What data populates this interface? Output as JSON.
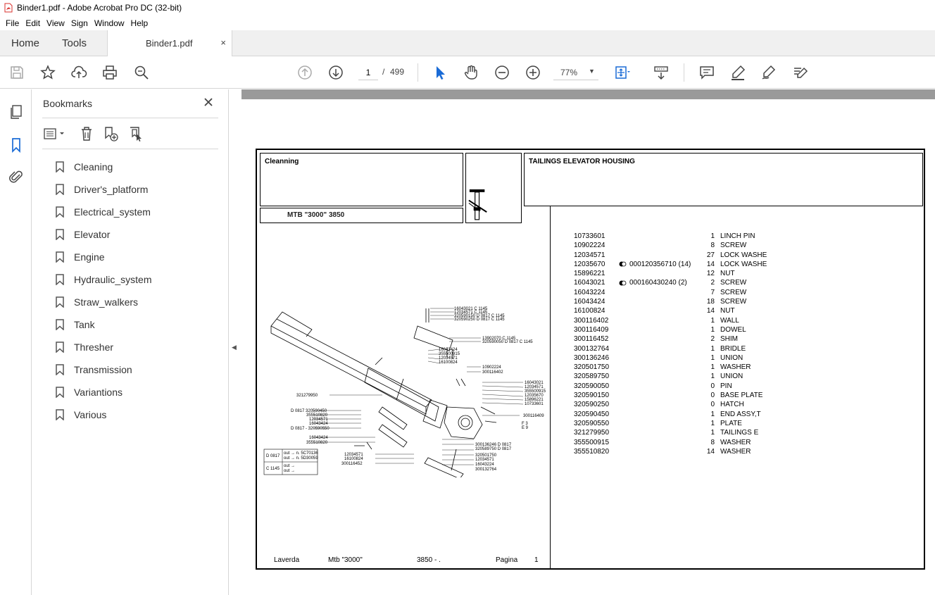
{
  "window": {
    "title": "Binder1.pdf - Adobe Acrobat Pro DC (32-bit)"
  },
  "menu": [
    "File",
    "Edit",
    "View",
    "Sign",
    "Window",
    "Help"
  ],
  "tabs": {
    "home": "Home",
    "tools": "Tools",
    "document": "Binder1.pdf",
    "close": "×"
  },
  "toolbar": {
    "page_current": "1",
    "page_separator": "/",
    "page_total": "499",
    "zoom": "77%"
  },
  "bookmarks": {
    "title": "Bookmarks",
    "close": "✕",
    "items": [
      "Cleaning",
      "Driver's_platform",
      "Electrical_system",
      "Elevator",
      "Engine",
      "Hydraulic_system",
      "Straw_walkers",
      "Tank",
      "Thresher",
      "Transmission",
      "Variantions",
      "Various"
    ]
  },
  "document": {
    "section": "Cleanning",
    "model_box": "MTB \"3000\" 3850",
    "heading": "TAILINGS ELEVATOR HOUSING",
    "parts": [
      {
        "num": "10733601",
        "ref": "",
        "qty": "1",
        "desc": "LINCH PIN"
      },
      {
        "num": "10902224",
        "ref": "",
        "qty": "8",
        "desc": "SCREW"
      },
      {
        "num": "12034571",
        "ref": "",
        "qty": "27",
        "desc": "LOCK WASHE"
      },
      {
        "num": "12035670",
        "ref": "000120356710  (14)",
        "qty": "14",
        "desc": "LOCK WASHE"
      },
      {
        "num": "15896221",
        "ref": "",
        "qty": "12",
        "desc": "NUT"
      },
      {
        "num": "16043021",
        "ref": "000160430240  (2)",
        "qty": "2",
        "desc": "SCREW"
      },
      {
        "num": "16043224",
        "ref": "",
        "qty": "7",
        "desc": "SCREW"
      },
      {
        "num": "16043424",
        "ref": "",
        "qty": "18",
        "desc": "SCREW"
      },
      {
        "num": "16100824",
        "ref": "",
        "qty": "14",
        "desc": "NUT"
      },
      {
        "num": "300116402",
        "ref": "",
        "qty": "1",
        "desc": "WALL"
      },
      {
        "num": "300116409",
        "ref": "",
        "qty": "1",
        "desc": "DOWEL"
      },
      {
        "num": "300116452",
        "ref": "",
        "qty": "2",
        "desc": "SHIM"
      },
      {
        "num": "300132764",
        "ref": "",
        "qty": "1",
        "desc": "BRIDLE"
      },
      {
        "num": "300136246",
        "ref": "",
        "qty": "1",
        "desc": "UNION"
      },
      {
        "num": "320501750",
        "ref": "",
        "qty": "1",
        "desc": "WASHER"
      },
      {
        "num": "320589750",
        "ref": "",
        "qty": "1",
        "desc": "UNION"
      },
      {
        "num": "320590050",
        "ref": "",
        "qty": "0",
        "desc": "PIN"
      },
      {
        "num": "320590150",
        "ref": "",
        "qty": "0",
        "desc": "BASE PLATE"
      },
      {
        "num": "320590250",
        "ref": "",
        "qty": "0",
        "desc": "HATCH"
      },
      {
        "num": "320590450",
        "ref": "",
        "qty": "1",
        "desc": "END ASSY,T"
      },
      {
        "num": "320590550",
        "ref": "",
        "qty": "1",
        "desc": "PLATE"
      },
      {
        "num": "321279950",
        "ref": "",
        "qty": "1",
        "desc": "TAILINGS E"
      },
      {
        "num": "355500915",
        "ref": "",
        "qty": "8",
        "desc": "WASHER"
      },
      {
        "num": "355510820",
        "ref": "",
        "qty": "14",
        "desc": "WASHER"
      }
    ],
    "footer": {
      "brand": "Laverda",
      "model": "Mtb \"3000\"",
      "code": "3850 - .",
      "page_label": "Pagina",
      "page_num": "1"
    },
    "callouts": {
      "c1": "16043021 C 1145",
      "c2": "12034571 C 1145",
      "c3": "320590150 D 0817 C 1145",
      "c4": "320590250 D 0817 C 1145",
      "c5": "13902070 C 1145",
      "c6": "320590050 D 0817 C 1145",
      "c7": "16043424",
      "c8": "355500915",
      "c9": "12034571",
      "c10": "16100824",
      "c11": "10902224",
      "c12": "300116402",
      "c13": "321279950",
      "c14": "16043021",
      "c15": "12034571",
      "c16": "355500915",
      "c17": "12035670",
      "c18": "15896221",
      "c19": "10733601",
      "c20": "300116409",
      "c21": "D 0817 320590450",
      "c22": "355510820",
      "c23": "12034571",
      "c24": "16043424",
      "c25": "D 0817 - 320590550",
      "c26": "16043424",
      "c27": "355510820",
      "c28": "12034571",
      "c29": "16100824",
      "c30": "300116452",
      "c31": "300136246 D 0817",
      "c32": "320589750 D 0817",
      "c33": "320501750",
      "c34": "12034571",
      "c35": "16043224",
      "c36": "300132764",
      "c37": "F 3",
      "c38": "E 9",
      "legend1": "D 0817",
      "legend1a": "out → n. 5C70136",
      "legend1b": "out → n. 5D30059",
      "legend2": "C 1145",
      "legend2a": "out →",
      "legend2b": "out →"
    }
  }
}
